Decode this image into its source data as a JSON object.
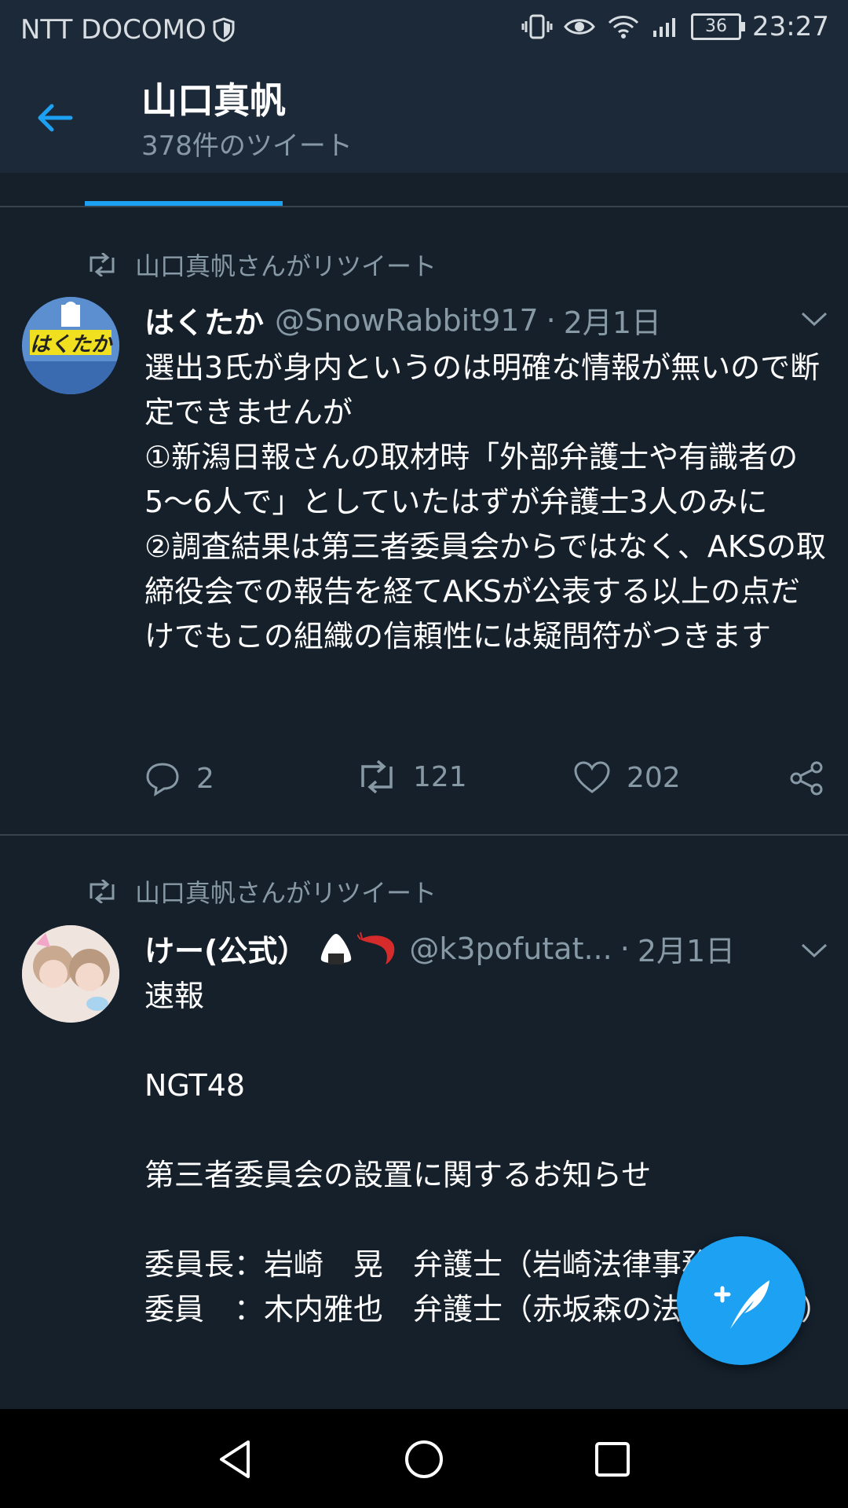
{
  "status_bar": {
    "carrier": "NTT DOCOMO",
    "battery": "36",
    "time": "23:27"
  },
  "header": {
    "title": "山口真帆",
    "subtitle": "378件のツイート"
  },
  "tweets": [
    {
      "retweet_label": "山口真帆さんがリツイート",
      "name": "はくたか",
      "handle": "@SnowRabbit917",
      "separator": "·",
      "date": "2月1日",
      "avatar_text": "はくたか",
      "body": "選出3氏が身内というのは明確な情報が無いので断定できませんが\n①新潟日報さんの取材時「外部弁護士や有識者の5〜6人で」としていたはずが弁護士3人のみに\n②調査結果は第三者委員会からではなく、AKSの取締役会での報告を経てAKSが公表する以上の点だけでもこの組織の信頼性には疑問符がつきます",
      "replies": "2",
      "retweets": "121",
      "likes": "202"
    },
    {
      "retweet_label": "山口真帆さんがリツイート",
      "name": "けー(公式）",
      "handle": "@k3pofutat...",
      "separator": "·",
      "date": "2月1日",
      "body": "速報\n\nNGT48\n\n第三者委員会の設置に関するお知らせ\n\n委員長：岩崎　晃　弁護士（岩崎法律事務所）\n委員　：木内雅也　弁護士（赤坂森の法律事務所）"
    }
  ],
  "colors": {
    "background": "#15202b",
    "header": "#1c2938",
    "accent": "#1da1f2",
    "muted": "#8899a6"
  }
}
